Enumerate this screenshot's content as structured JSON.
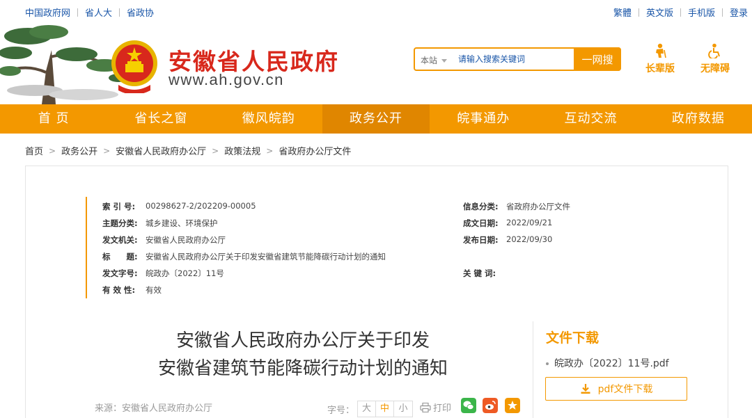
{
  "top_links_left": [
    "中国政府网",
    "省人大",
    "省政协"
  ],
  "top_links_right": [
    "繁體",
    "英文版",
    "手机版",
    "登录"
  ],
  "header": {
    "title": "安徽省人民政府",
    "url": "www.ah.gov.cn"
  },
  "search": {
    "scope": "本站",
    "placeholder": "请输入搜索关键词",
    "button": "一网搜"
  },
  "tools": {
    "elder": "长辈版",
    "accessible": "无障碍"
  },
  "nav": {
    "items": [
      "首 页",
      "省长之窗",
      "徽风皖韵",
      "政务公开",
      "皖事通办",
      "互动交流",
      "政府数据"
    ],
    "active_index": 3
  },
  "breadcrumb": [
    "首页",
    "政务公开",
    "安徽省人民政府办公厅",
    "政策法规",
    "省政府办公厅文件"
  ],
  "meta": {
    "index_label": "索 引 号:",
    "index_value": "00298627-2/202209-00005",
    "category_label": "信息分类:",
    "category_value": "省政府办公厅文件",
    "topic_label": "主题分类:",
    "topic_value": "城乡建设、环境保护",
    "written_label": "成文日期:",
    "written_value": "2022/09/21",
    "issuer_label": "发文机关:",
    "issuer_value": "安徽省人民政府办公厅",
    "published_label": "发布日期:",
    "published_value": "2022/09/30",
    "title_label": "标　　题:",
    "title_value": "安徽省人民政府办公厅关于印发安徽省建筑节能降碳行动计划的通知",
    "docno_label": "发文字号:",
    "docno_value": "皖政办〔2022〕11号",
    "keywords_label": "关 键 词:",
    "keywords_value": "",
    "valid_label": "有 效 性:",
    "valid_value": "有效"
  },
  "document": {
    "title_line1": "安徽省人民政府办公厅关于印发",
    "title_line2": "安徽省建筑节能降碳行动计划的通知",
    "source": "来源：安徽省人民政府办公厅",
    "fontsize_label": "字号：",
    "fontsize_options": [
      "大",
      "中",
      "小"
    ],
    "fontsize_selected": "中",
    "print": "打印"
  },
  "download": {
    "title": "文件下载",
    "file": "皖政办〔2022〕11号.pdf",
    "button": "pdf文件下载"
  },
  "colors": {
    "accent": "#f39800",
    "title_red": "#d8281c",
    "link_blue": "#1a56a8",
    "wechat": "#3bb54a",
    "weibo": "#ee5a24"
  }
}
